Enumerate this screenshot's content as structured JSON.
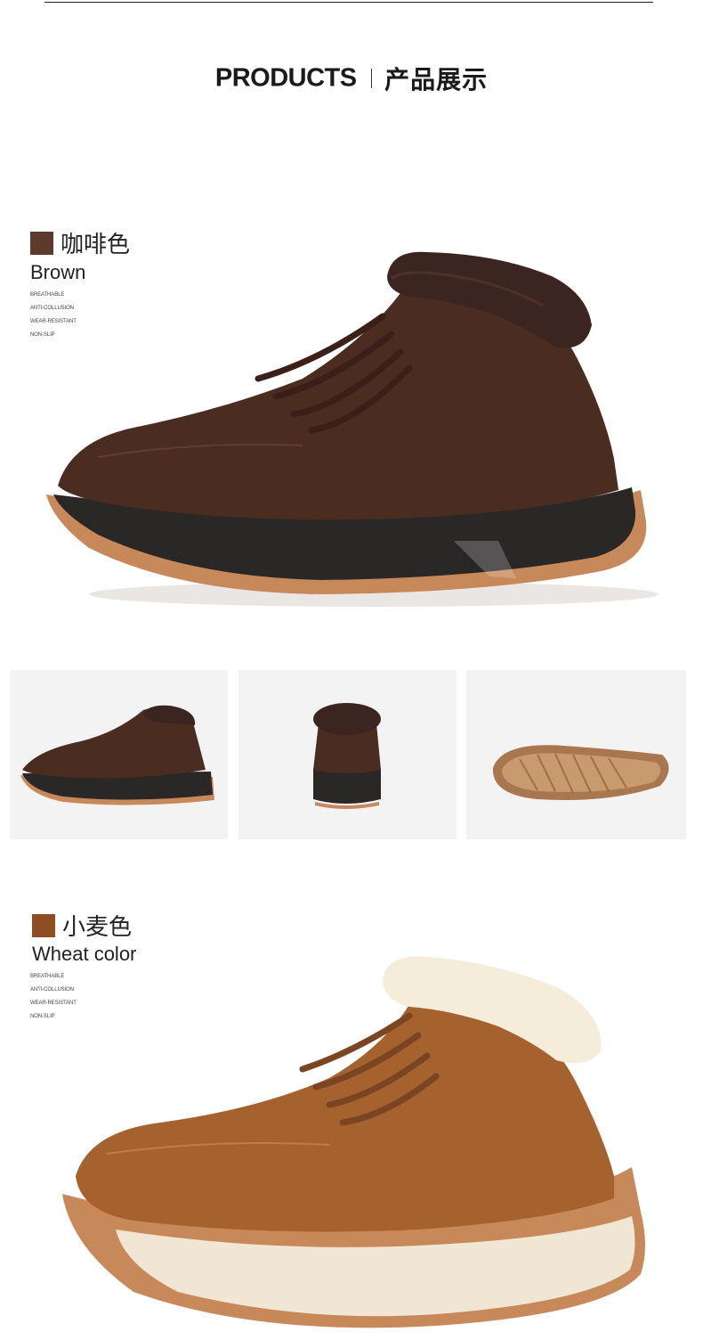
{
  "header": {
    "title_en": "PRODUCTS",
    "title_cn": "产品展示"
  },
  "variants": [
    {
      "name_cn": "咖啡色",
      "name_en": "Brown",
      "swatch_color": "#5b3b2c",
      "features": [
        "BREATHABLE",
        "ANTI-COLLUSION",
        "WEAR-RESISTANT",
        "NON-SLIP"
      ]
    },
    {
      "name_cn": "小麦色",
      "name_en": "Wheat color",
      "swatch_color": "#8e4d22",
      "features": [
        "BREATHABLE",
        "ANTI-COLLUSION",
        "WEAR-RESISTANT",
        "NON-SLIP"
      ]
    }
  ],
  "colors": {
    "brown_suede": "#4a2c21",
    "wheat_suede": "#a5622e",
    "gum_rim": "#c8895a",
    "black_sole": "#2a2727",
    "cream_sole": "#f1e6d4",
    "fur_cream": "#f5ecd9"
  }
}
